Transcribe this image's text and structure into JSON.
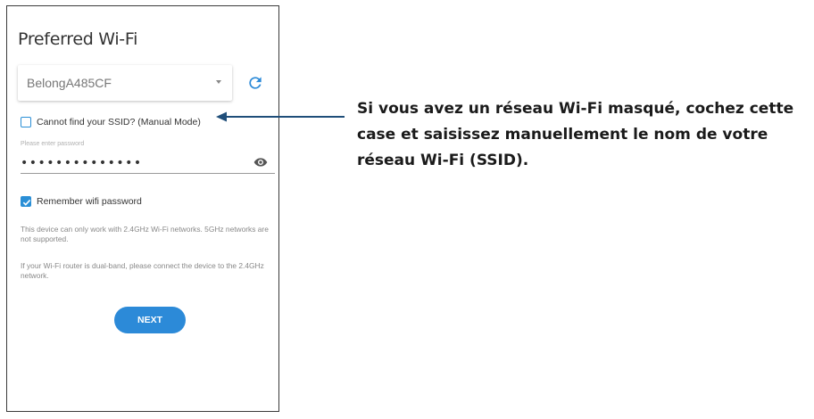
{
  "screen": {
    "title": "Preferred Wi-Fi",
    "ssid_select": {
      "value": "BelongA485CF"
    },
    "refresh_icon": "refresh-icon",
    "manual_mode": {
      "label": "Cannot find your SSID? (Manual Mode)",
      "checked": false
    },
    "password": {
      "hint": "Please enter password",
      "value": "••••••••••••••"
    },
    "show_password_icon": "eye-icon",
    "remember": {
      "label": "Remember wifi password",
      "checked": true
    },
    "notes": [
      "This device can only work with 2.4GHz Wi-Fi networks. 5GHz networks are not supported.",
      "If your Wi-Fi router is dual-band, please connect the device to the 2.4GHz network."
    ],
    "next_label": "NEXT"
  },
  "annotation": {
    "text": "Si vous avez un réseau Wi-Fi masqué, cochez cette case et saisissez manuellement le nom de votre réseau Wi-Fi (SSID)."
  },
  "colors": {
    "accent": "#2c8ad8",
    "arrow": "#1f4e79",
    "text": "#333333",
    "muted": "#888888"
  }
}
